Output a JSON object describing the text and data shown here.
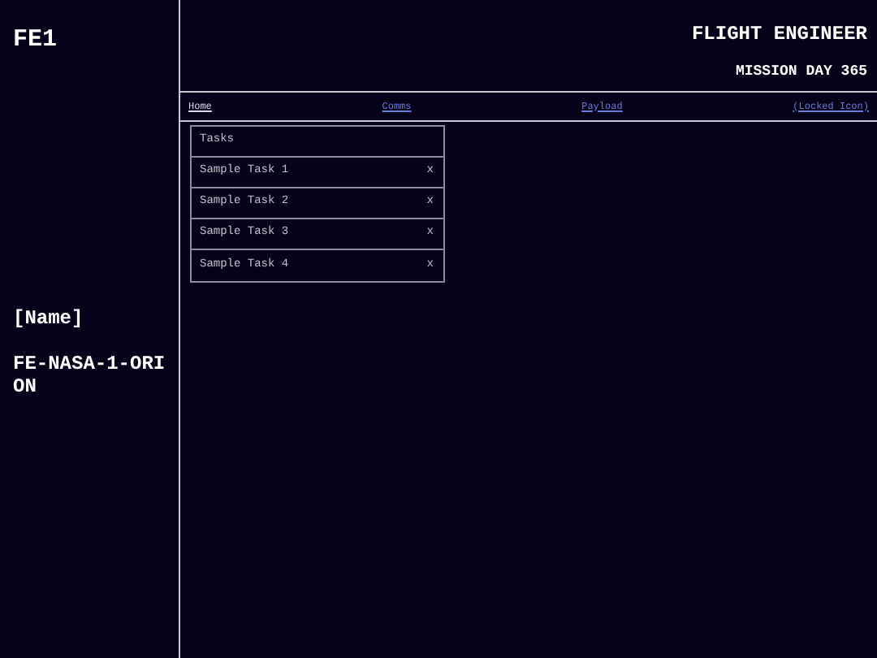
{
  "sidebar": {
    "code": "FE1",
    "name": "[Name]",
    "id": "FE-NASA-1-ORION"
  },
  "header": {
    "title": "FLIGHT ENGINEER",
    "subtitle": "MISSION DAY 365"
  },
  "nav": [
    {
      "label": "Home",
      "selected": true
    },
    {
      "label": "Comms",
      "selected": false
    },
    {
      "label": "Payload",
      "selected": false
    },
    {
      "label": "(Locked Icon)",
      "selected": false
    }
  ],
  "tasks": {
    "title": "Tasks",
    "items": [
      {
        "label": "Sample Task 1",
        "remove": "x"
      },
      {
        "label": "Sample Task 2",
        "remove": "x"
      },
      {
        "label": "Sample Task 3",
        "remove": "x"
      },
      {
        "label": "Sample Task 4",
        "remove": "x"
      }
    ]
  }
}
